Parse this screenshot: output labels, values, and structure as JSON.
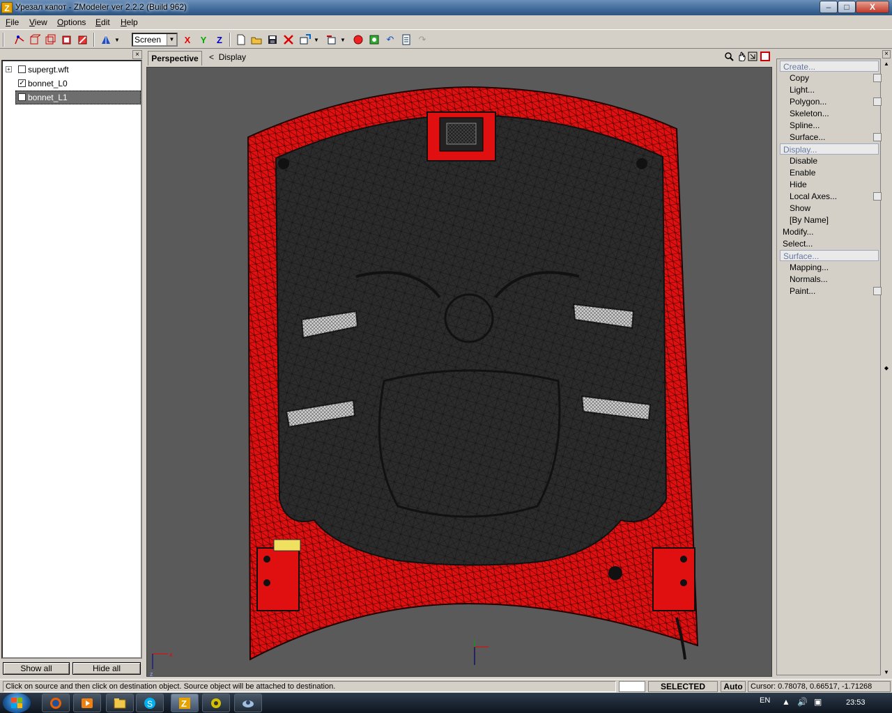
{
  "window": {
    "title": "Урезал капот - ZModeler ver 2.2.2 (Build 962)",
    "app_icon": "Z",
    "minimize": "–",
    "maximize": "□",
    "close": "X"
  },
  "menu": [
    {
      "first": "F",
      "rest": "ile"
    },
    {
      "first": "V",
      "rest": "iew"
    },
    {
      "first": "O",
      "rest": "ptions"
    },
    {
      "first": "E",
      "rest": "dit"
    },
    {
      "first": "H",
      "rest": "elp"
    }
  ],
  "toolbar": {
    "screen_select": "Screen",
    "axis_x": "X",
    "axis_y": "Y",
    "axis_z": "Z"
  },
  "tree": {
    "items": [
      {
        "label": "supergt.wft",
        "expander": "+",
        "checked": false
      },
      {
        "label": "bonnet_L0",
        "checked": true,
        "check_mark": "✓"
      },
      {
        "label": "bonnet_L1",
        "checked": false,
        "selected": true
      }
    ],
    "show_all": "Show all",
    "hide_all": "Hide all"
  },
  "viewport": {
    "tab": "Perspective",
    "crumb_arrow": "<",
    "crumb": "Display",
    "axis_x": "x",
    "axis_z": "z"
  },
  "commands": {
    "create_header": "Create...",
    "create_items": [
      "Copy",
      "Light...",
      "Polygon...",
      "Skeleton...",
      "Spline...",
      "Surface..."
    ],
    "display_header": "Display...",
    "display_items": [
      "Disable",
      "Enable",
      "Hide",
      "Local Axes...",
      "Show",
      "[By Name]"
    ],
    "modify": "Modify...",
    "select": "Select...",
    "surface_header": "Surface...",
    "surface_items": [
      "Mapping...",
      "Normals...",
      "Paint..."
    ]
  },
  "status": {
    "message": "Click on source and then click on destination object. Source object will be attached to destination.",
    "mode": "SELECTED MODE",
    "auto": "Auto",
    "cursor": "Cursor: 0.78078, 0.66517, -1.71268"
  },
  "taskbar": {
    "lang": "EN",
    "time": "23:53"
  },
  "colors": {
    "model_red": "#e01010",
    "model_dark": "#2a2a2a",
    "viewport_bg": "#5a5a5a",
    "selection": "#6e6e6e"
  }
}
